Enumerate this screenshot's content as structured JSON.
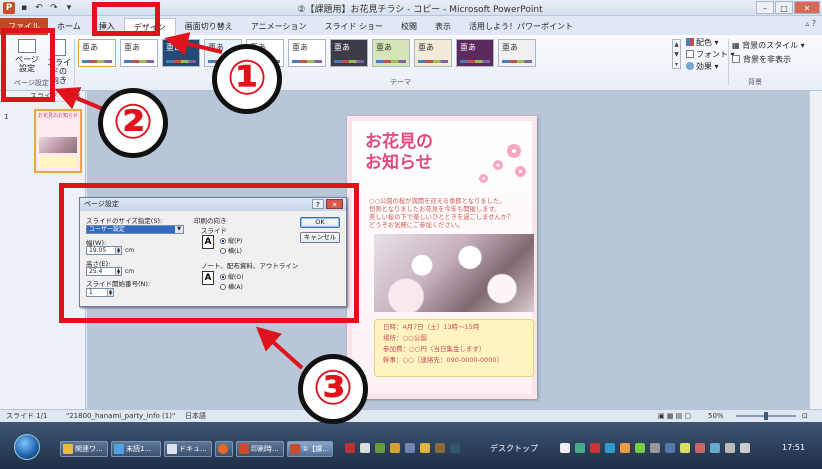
{
  "window": {
    "title": "②【課題用】お花見チラシ - コピー - Microsoft PowerPoint",
    "app_icon": "P"
  },
  "tabs": [
    "ファイル",
    "ホーム",
    "挿入",
    "デザイン",
    "画面切り替え",
    "アニメーション",
    "スライド ショー",
    "校閲",
    "表示",
    "活用しよう！パワーポイント"
  ],
  "ribbon": {
    "page_setup_label": "ページ\n設定",
    "orientation_label": "スライドの\n向き",
    "page_group_label": "ページ設定",
    "theme_sample": "亜あ",
    "themes_group_label": "テーマ",
    "colors_label": "配色",
    "fonts_label": "フォント",
    "effects_label": "効果",
    "bg_styles_label": "背景のスタイル",
    "hide_bg_label": "背景を非表示",
    "bg_group_label": "背景"
  },
  "slide_panel": {
    "tabs_label": "スライド",
    "slide_number": "1",
    "thumb_title": "お花見のお知らせ"
  },
  "slide": {
    "title_line1": "お花見の",
    "title_line2": "お知らせ",
    "body_lines": [
      "○○公園の桜が満開を迎える季節となりました。",
      "恒例となりましたお花見を今年も開催します。",
      "美しい桜の下で楽しいひとときを過ごしませんか？",
      "どうぞお気軽にご参加ください。"
    ],
    "info": [
      "日時：4月7日（土）13時〜15時",
      "場所：○○公園",
      "参加費：○○円（当日集金します）",
      "幹事：○○（連絡先：090-0000-0000）"
    ]
  },
  "dialog": {
    "title": "ページ設定",
    "size_label": "スライドのサイズ指定(S):",
    "size_value": "ユーザー設定",
    "width_label": "幅(W):",
    "width_value": "19.05",
    "height_label": "高さ(E):",
    "height_value": "25.4",
    "start_label": "スライド開始番号(N):",
    "start_value": "1",
    "unit": "cm",
    "orientation_heading": "印刷の向き",
    "slide_heading": "スライド",
    "portrait1": "縦(P)",
    "landscape1": "横(L)",
    "notes_heading": "ノート、配布資料、アウトライン",
    "portrait2": "縦(O)",
    "landscape2": "横(A)",
    "ok": "OK",
    "cancel": "キャンセル"
  },
  "statusbar": {
    "slide_info": "スライド 1/1",
    "theme_name": "\"21800_hanami_party_info (1)\"",
    "language": "日本語",
    "zoom": "50%"
  },
  "taskbar": {
    "items": [
      "関連ワ...",
      "未読1...",
      "ドキュ...",
      "",
      "印刷時...",
      "②【課..."
    ],
    "desktop_label": "デスクトップ",
    "clock": "17:51"
  },
  "annotations": {
    "num1": "①",
    "num2": "②",
    "num3": "③"
  },
  "colors": {
    "annotation_red": "#e0121b",
    "file_tab": "#c24a27",
    "slide_title": "#e0487f"
  }
}
